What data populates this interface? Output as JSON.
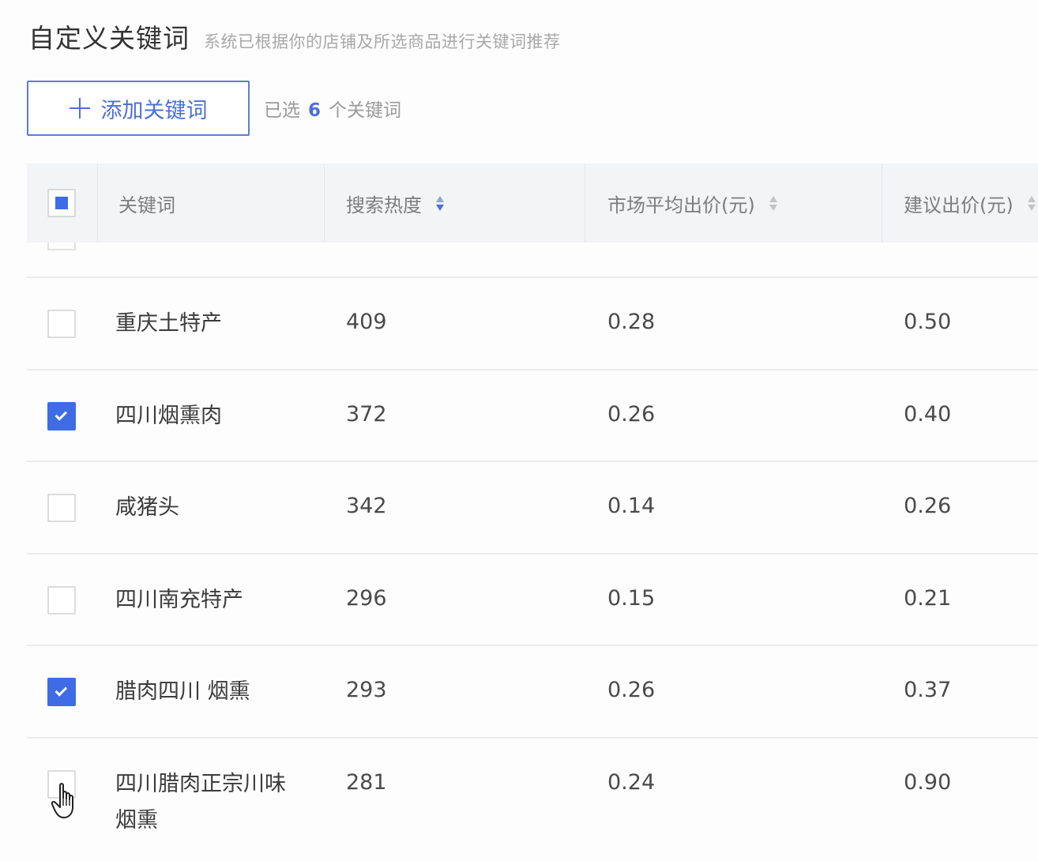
{
  "header": {
    "title": "自定义关键词",
    "subtitle": "系统已根据你的店铺及所选商品进行关键词推荐"
  },
  "toolbar": {
    "add_label": "添加关键词",
    "selected_prefix": "已选",
    "selected_count": "6",
    "selected_suffix": "个关键词"
  },
  "table": {
    "columns": {
      "keyword": "关键词",
      "search_heat": "搜索热度",
      "market_avg_bid": "市场平均出价(元)",
      "suggested_bid": "建议出价(元)"
    },
    "rows": [
      {
        "keyword": "重庆土特产",
        "search_heat": "409",
        "market_avg_bid": "0.28",
        "suggested_bid": "0.50",
        "checked": false
      },
      {
        "keyword": "四川烟熏肉",
        "search_heat": "372",
        "market_avg_bid": "0.26",
        "suggested_bid": "0.40",
        "checked": true
      },
      {
        "keyword": "咸猪头",
        "search_heat": "342",
        "market_avg_bid": "0.14",
        "suggested_bid": "0.26",
        "checked": false
      },
      {
        "keyword": "四川南充特产",
        "search_heat": "296",
        "market_avg_bid": "0.15",
        "suggested_bid": "0.21",
        "checked": false
      },
      {
        "keyword": "腊肉四川 烟熏",
        "search_heat": "293",
        "market_avg_bid": "0.26",
        "suggested_bid": "0.37",
        "checked": true
      },
      {
        "keyword": "四川腊肉正宗川味 烟熏",
        "search_heat": "281",
        "market_avg_bid": "0.24",
        "suggested_bid": "0.90",
        "checked": false
      }
    ]
  },
  "colors": {
    "accent": "#3d6ce4",
    "header_bg": "#f3f4f6"
  }
}
